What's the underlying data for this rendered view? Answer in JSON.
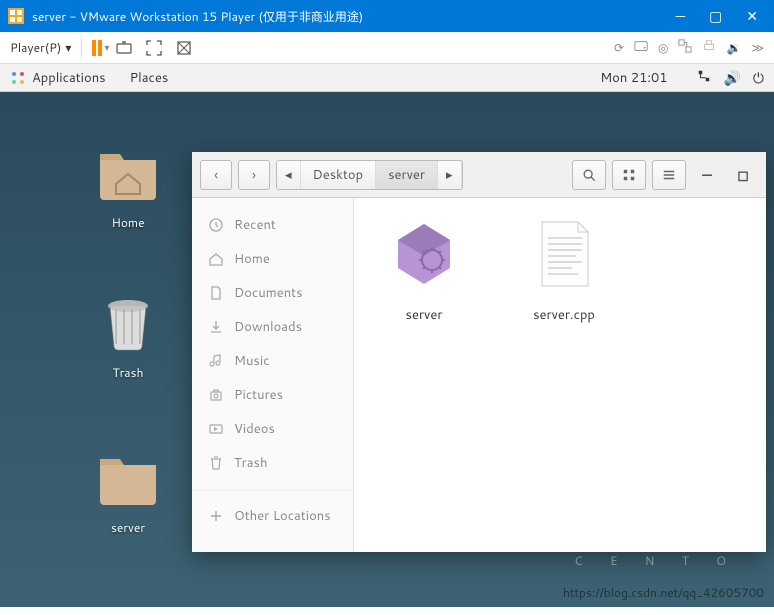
{
  "vmware": {
    "title": "server - VMware Workstation 15 Player (仅用于非商业用途)",
    "player_menu": "Player(P)"
  },
  "gnome": {
    "applications": "Applications",
    "places": "Places",
    "clock": "Mon 21:01"
  },
  "desktop_icons": {
    "home": "Home",
    "trash": "Trash",
    "server": "server"
  },
  "file_manager": {
    "path": {
      "desktop": "Desktop",
      "current": "server"
    },
    "sidebar": {
      "recent": "Recent",
      "home": "Home",
      "documents": "Documents",
      "downloads": "Downloads",
      "music": "Music",
      "pictures": "Pictures",
      "videos": "Videos",
      "trash": "Trash",
      "other": "Other Locations"
    },
    "files": {
      "server": "server",
      "server_cpp": "server.cpp"
    }
  },
  "watermark": {
    "cent": "C  E  N  T  O",
    "url": "https://blog.csdn.net/qq_42605700"
  }
}
